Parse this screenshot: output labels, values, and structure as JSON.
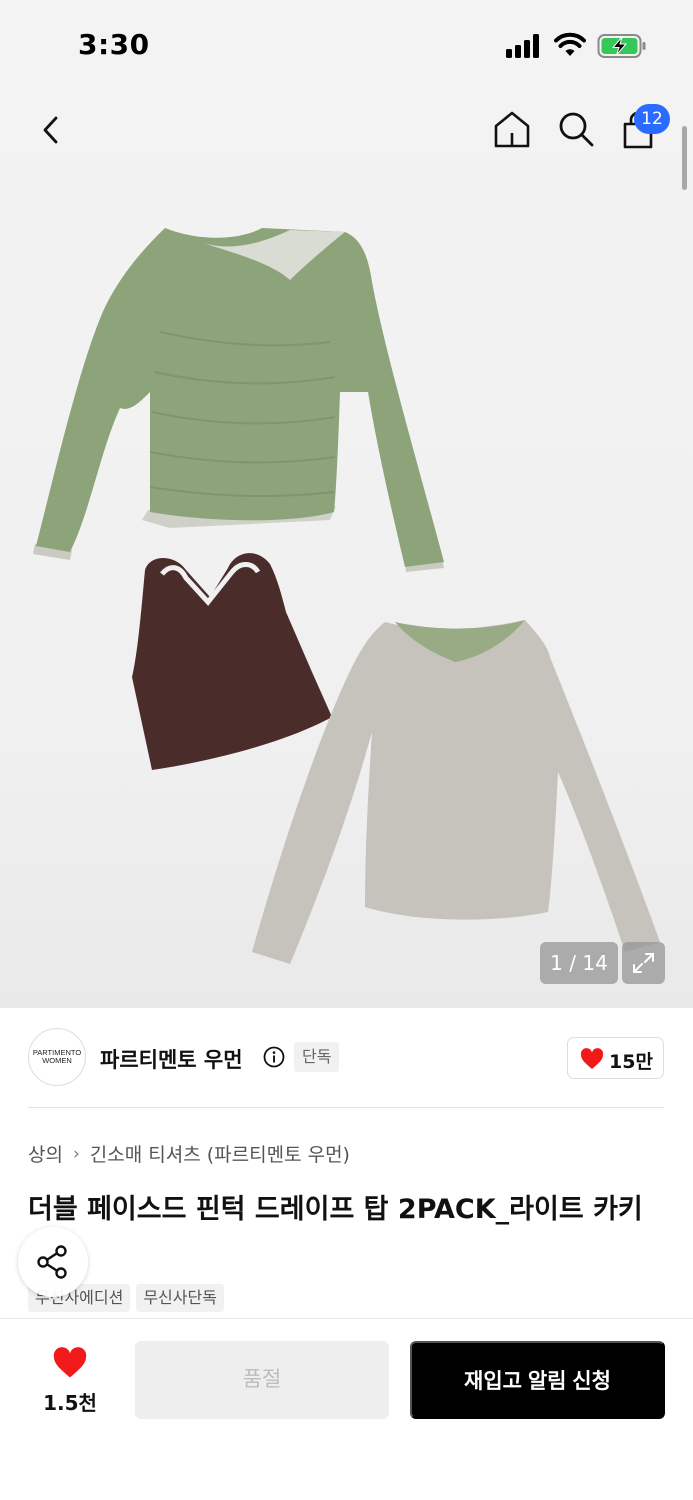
{
  "status_bar": {
    "time": "3:30"
  },
  "header": {
    "cart_count": "12"
  },
  "gallery": {
    "counter": "1 / 14"
  },
  "brand": {
    "logo_text_line1": "PARTIMENTO",
    "logo_text_line2": "WOMEN",
    "name": "파르티멘토 우먼",
    "exclusive_tag": "단독",
    "like_count": "15만"
  },
  "breadcrumb": {
    "category": "상의",
    "subcategory": "긴소매 티셔츠 (파르티멘토 우먼)"
  },
  "product": {
    "title": "더블 페이스드 핀턱 드레이프 탑 2PACK_라이트 카키",
    "tags": [
      "무신사에디션",
      "무신사단독"
    ]
  },
  "bottom_bar": {
    "wish_count": "1.5천",
    "soldout_label": "품절",
    "restock_label": "재입고 알림 신청"
  },
  "colors": {
    "accent_blue": "#2c6bff",
    "heart_red": "#f01a1a",
    "primary_button": "#000000",
    "disabled_button": "#eeeeee"
  }
}
